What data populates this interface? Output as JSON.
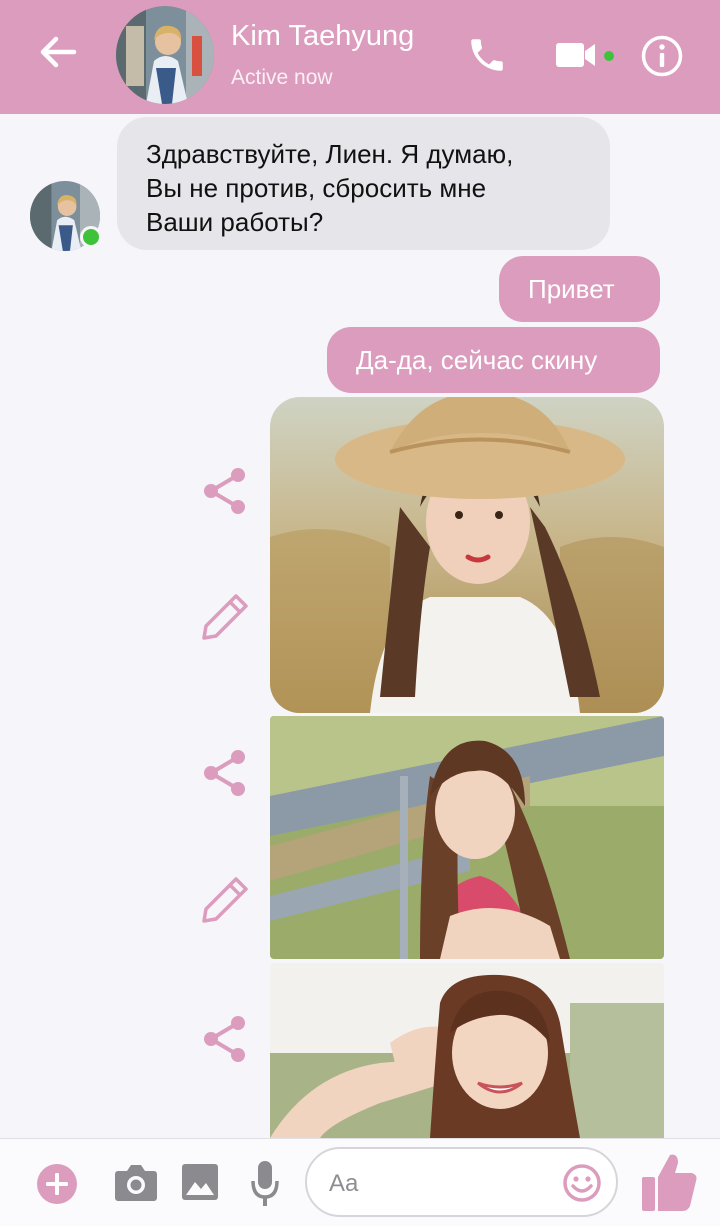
{
  "colors": {
    "accent": "#dc9cbd",
    "incoming_bubble": "#e6e5ea",
    "online": "#3ec23a",
    "background": "#f6f5f9"
  },
  "header": {
    "contact_name": "Kim Taehyung",
    "status": "Active now",
    "icons": [
      "back-arrow-icon",
      "phone-icon",
      "video-camera-icon",
      "info-icon"
    ]
  },
  "messages": {
    "incoming": {
      "text": "Здравствуйте, Лиен. Я думаю,\nВы не против, сбросить мне\nВаши работы?"
    },
    "outgoing": [
      {
        "text": "Привет"
      },
      {
        "text": "Да-да, сейчас скину"
      }
    ],
    "photos": [
      {
        "subject": "girl in straw hat with braids in field"
      },
      {
        "subject": "girl with long brown hair outdoors"
      },
      {
        "subject": "smiling girl saluting outdoors"
      }
    ]
  },
  "composer": {
    "placeholder": "Aa",
    "icons": [
      "plus-icon",
      "camera-icon",
      "image-icon",
      "microphone-icon",
      "emoji-icon",
      "thumbs-up-icon"
    ]
  }
}
